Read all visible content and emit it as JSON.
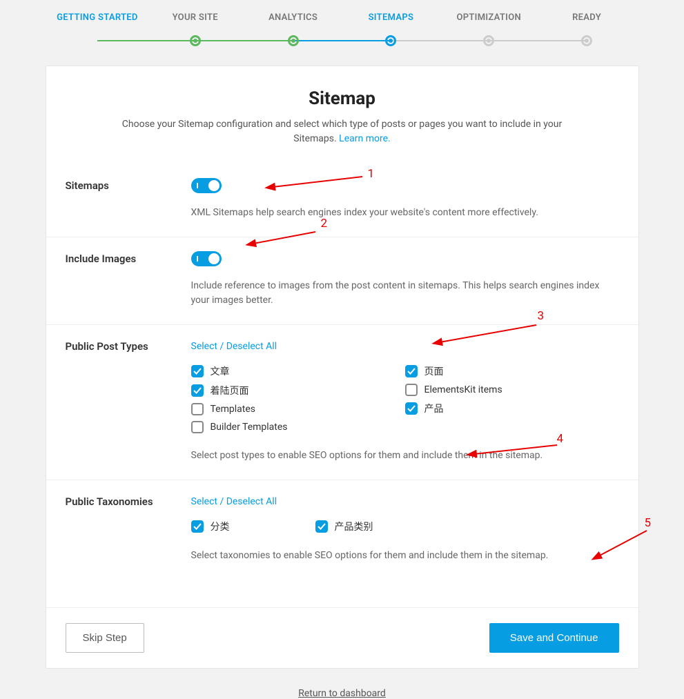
{
  "stepper": {
    "steps": [
      {
        "label": "GETTING STARTED"
      },
      {
        "label": "YOUR SITE"
      },
      {
        "label": "ANALYTICS"
      },
      {
        "label": "SITEMAPS"
      },
      {
        "label": "OPTIMIZATION"
      },
      {
        "label": "READY"
      }
    ]
  },
  "page": {
    "title": "Sitemap",
    "subtitle_pre": "Choose your Sitemap configuration and select which type of posts or pages you want to include in your Sitemaps. ",
    "learn_more": "Learn more."
  },
  "sections": {
    "sitemaps": {
      "label": "Sitemaps",
      "hint": "XML Sitemaps help search engines index your website's content more effectively."
    },
    "include_images": {
      "label": "Include Images",
      "hint": "Include reference to images from the post content in sitemaps. This helps search engines index your images better."
    },
    "post_types": {
      "label": "Public Post Types",
      "select_all": "Select / Deselect All",
      "col1": [
        {
          "label": "文章",
          "checked": true
        },
        {
          "label": "着陆页面",
          "checked": true
        },
        {
          "label": "Templates",
          "checked": false
        },
        {
          "label": "Builder Templates",
          "checked": false
        }
      ],
      "col2": [
        {
          "label": "页面",
          "checked": true
        },
        {
          "label": "ElementsKit items",
          "checked": false
        },
        {
          "label": "产品",
          "checked": true
        }
      ],
      "hint": "Select post types to enable SEO options for them and include them in the sitemap."
    },
    "taxonomies": {
      "label": "Public Taxonomies",
      "select_all": "Select / Deselect All",
      "items": [
        {
          "label": "分类",
          "checked": true
        },
        {
          "label": "产品类别",
          "checked": true
        }
      ],
      "hint": "Select taxonomies to enable SEO options for them and include them in the sitemap."
    }
  },
  "footer": {
    "skip": "Skip Step",
    "save": "Save and Continue",
    "return": "Return to dashboard"
  },
  "annotations": [
    "1",
    "2",
    "3",
    "4",
    "5"
  ]
}
